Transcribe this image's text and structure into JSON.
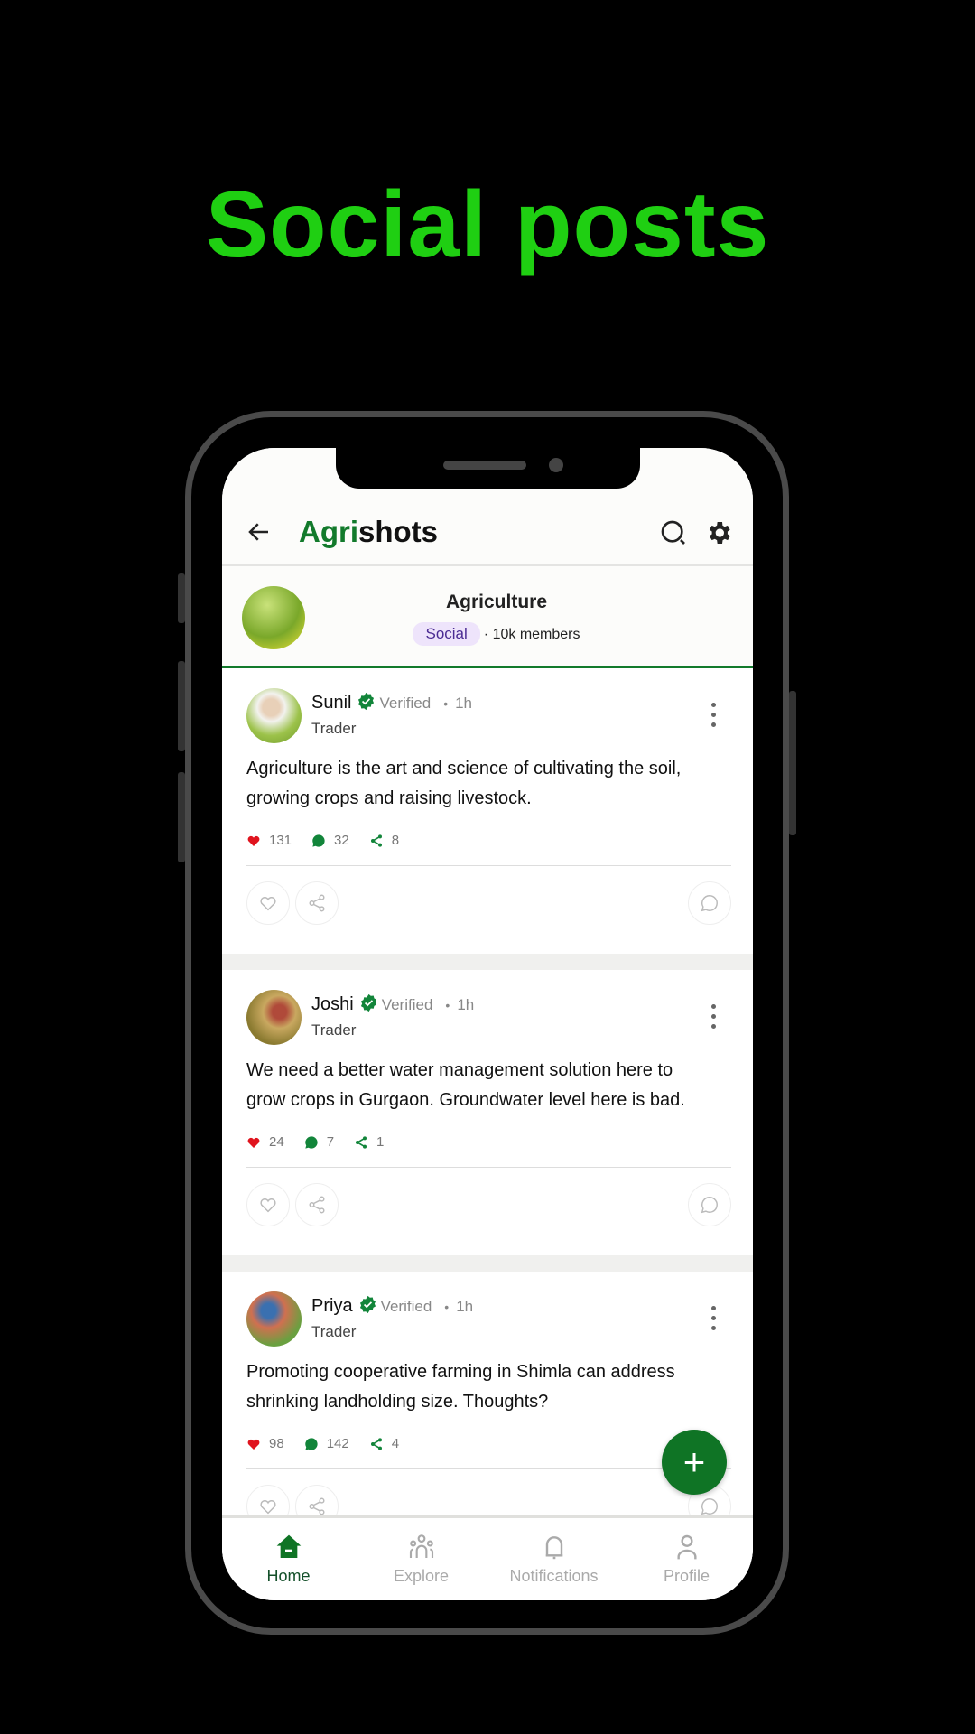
{
  "headline": "Social posts",
  "header": {
    "logo_green": "Agri",
    "logo_rest": "shots",
    "icons": [
      "back-arrow-icon",
      "search-icon",
      "gear-icon"
    ]
  },
  "group": {
    "name": "Agriculture",
    "category": "Social",
    "members": "· 10k members"
  },
  "verified_label": "Verified",
  "posts": [
    {
      "name": "Sunil",
      "time": "1h",
      "role": "Trader",
      "text": "Agriculture is the art and science of cultivating the soil, growing crops and raising livestock.",
      "likes": "131",
      "comments": "32",
      "shares": "8"
    },
    {
      "name": "Joshi",
      "time": "1h",
      "role": "Trader",
      "text": "We need a better water management solution here to grow crops in Gurgaon. Groundwater level here is bad.",
      "likes": "24",
      "comments": "7",
      "shares": "1"
    },
    {
      "name": "Priya",
      "time": "1h",
      "role": "Trader",
      "text": "Promoting cooperative farming in Shimla can address shrinking landholding size. Thoughts?",
      "likes": "98",
      "comments": "142",
      "shares": "4"
    }
  ],
  "fab": "+",
  "nav": [
    {
      "label": "Home",
      "active": true
    },
    {
      "label": "Explore"
    },
    {
      "label": "Notifications"
    },
    {
      "label": "Profile"
    }
  ],
  "colors": {
    "brand": "#127a2b",
    "headline": "#1fcf12",
    "like": "#e0141e",
    "badge_bg": "#eee4fb"
  }
}
